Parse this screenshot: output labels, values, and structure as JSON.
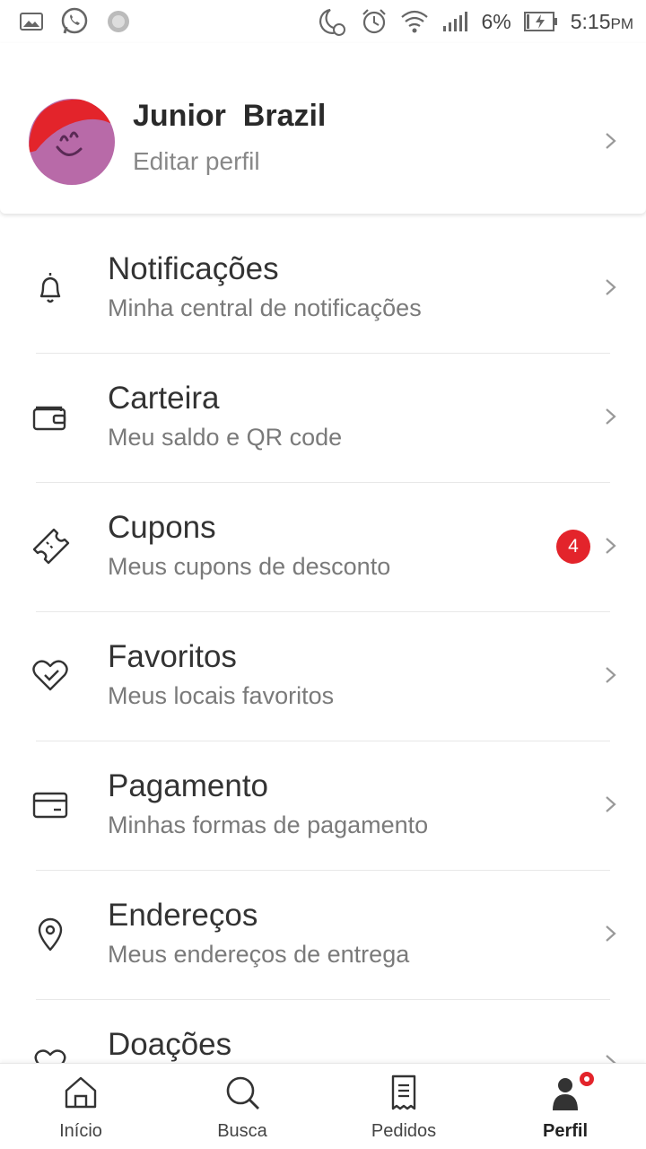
{
  "status_bar": {
    "battery": "6%",
    "time": "5:15",
    "ampm": "PM",
    "icons": [
      "image-icon",
      "whatsapp-icon",
      "sync-icon",
      "moon-icon",
      "alarm-icon",
      "wifi-icon",
      "signal-icon",
      "battery-charging-icon"
    ]
  },
  "profile": {
    "name": "Junior  Brazil",
    "subtitle": "Editar perfil"
  },
  "menu": [
    {
      "title": "Notificações",
      "subtitle": "Minha central de notificações",
      "icon": "bell-icon"
    },
    {
      "title": "Carteira",
      "subtitle": "Meu saldo e QR code",
      "icon": "wallet-icon"
    },
    {
      "title": "Cupons",
      "subtitle": "Meus cupons de desconto",
      "icon": "ticket-icon",
      "badge": "4"
    },
    {
      "title": "Favoritos",
      "subtitle": "Meus locais favoritos",
      "icon": "heart-check-icon"
    },
    {
      "title": "Pagamento",
      "subtitle": "Minhas formas de pagamento",
      "icon": "card-icon"
    },
    {
      "title": "Endereços",
      "subtitle": "Meus endereços de entrega",
      "icon": "location-pin-icon"
    },
    {
      "title": "Doações",
      "subtitle": "",
      "icon": "heart-icon"
    }
  ],
  "bottom_nav": [
    {
      "label": "Início",
      "icon": "home-icon"
    },
    {
      "label": "Busca",
      "icon": "search-icon"
    },
    {
      "label": "Pedidos",
      "icon": "receipt-icon"
    },
    {
      "label": "Perfil",
      "icon": "profile-icon",
      "active": true
    }
  ],
  "colors": {
    "accent": "#e3242b",
    "avatar_bg": "#b86aa8"
  }
}
